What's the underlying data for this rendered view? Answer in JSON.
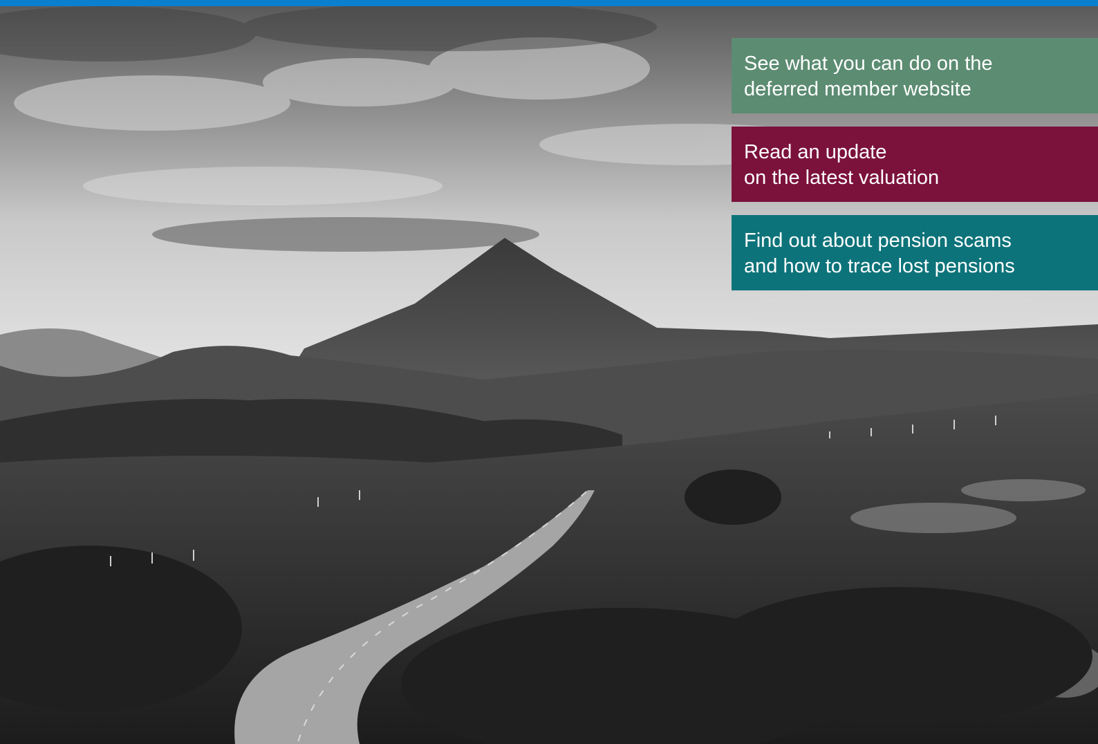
{
  "colors": {
    "top_bar": "#0a7fd0",
    "callout_green": "#5c8c72",
    "callout_maroon": "#7b123c",
    "callout_teal": "#0d737a"
  },
  "hero": {
    "image": "black-and-white-mountain-landscape-with-winding-road"
  },
  "callouts": [
    {
      "line1": "See what you can do on the",
      "line2": "deferred member website"
    },
    {
      "line1": "Read an update",
      "line2": "on the latest valuation"
    },
    {
      "line1": "Find out about pension scams",
      "line2": "and how to trace lost pensions"
    }
  ]
}
